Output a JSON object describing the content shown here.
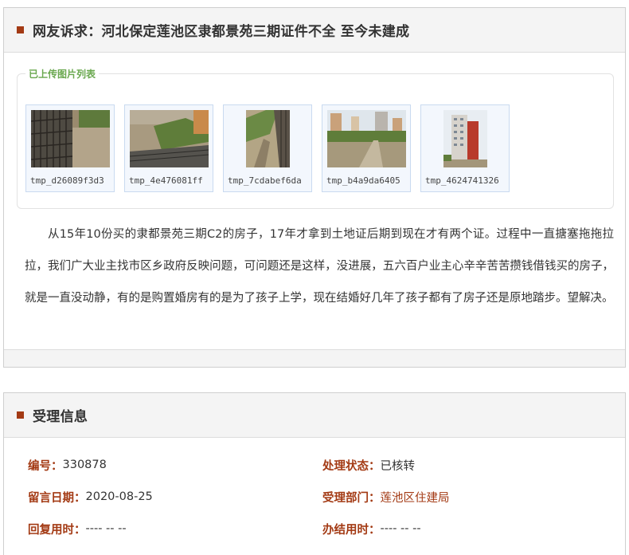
{
  "complaint": {
    "title": "网友诉求：河北保定莲池区隶都景苑三期证件不全 至今未建成",
    "upload_legend": "已上传图片列表",
    "images": [
      {
        "name": "tmp_d26089f3d3",
        "thumb_icon": "construction-rebar-photo"
      },
      {
        "name": "tmp_4e476081ff",
        "thumb_icon": "construction-trench-photo"
      },
      {
        "name": "tmp_7cdabef6da",
        "thumb_icon": "ditch-photo"
      },
      {
        "name": "tmp_b4a9da6405",
        "thumb_icon": "site-road-photo"
      },
      {
        "name": "tmp_4624741326",
        "thumb_icon": "apartment-building-photo"
      }
    ],
    "text": "从15年10份买的隶都景苑三期C2的房子，17年才拿到土地证后期到现在才有两个证。过程中一直搪塞拖拖拉拉，我们广大业主找市区乡政府反映问题，可问题还是这样，没进展，五六百户业主心辛辛苦苦攒钱借钱买的房子，就是一直没动静，有的是购置婚房有的是为了孩子上学，现在结婚好几年了孩子都有了房子还是原地踏步。望解决。"
  },
  "acceptance": {
    "title": "受理信息",
    "rows": [
      [
        {
          "label": "编号：",
          "value": "330878"
        },
        {
          "label": "处理状态：",
          "value": "已核转"
        }
      ],
      [
        {
          "label": "留言日期：",
          "value": "2020-08-25"
        },
        {
          "label": "受理部门：",
          "value": "莲池区住建局"
        }
      ],
      [
        {
          "label": "回复用时：",
          "value": "---- -- --"
        },
        {
          "label": "办结用时：",
          "value": "---- -- --"
        }
      ]
    ]
  },
  "colors": {
    "accent": "#a33a14",
    "legend_green": "#6aa84f",
    "header_bg": "#f4f4f4",
    "thumb_border": "#c9daf0"
  }
}
